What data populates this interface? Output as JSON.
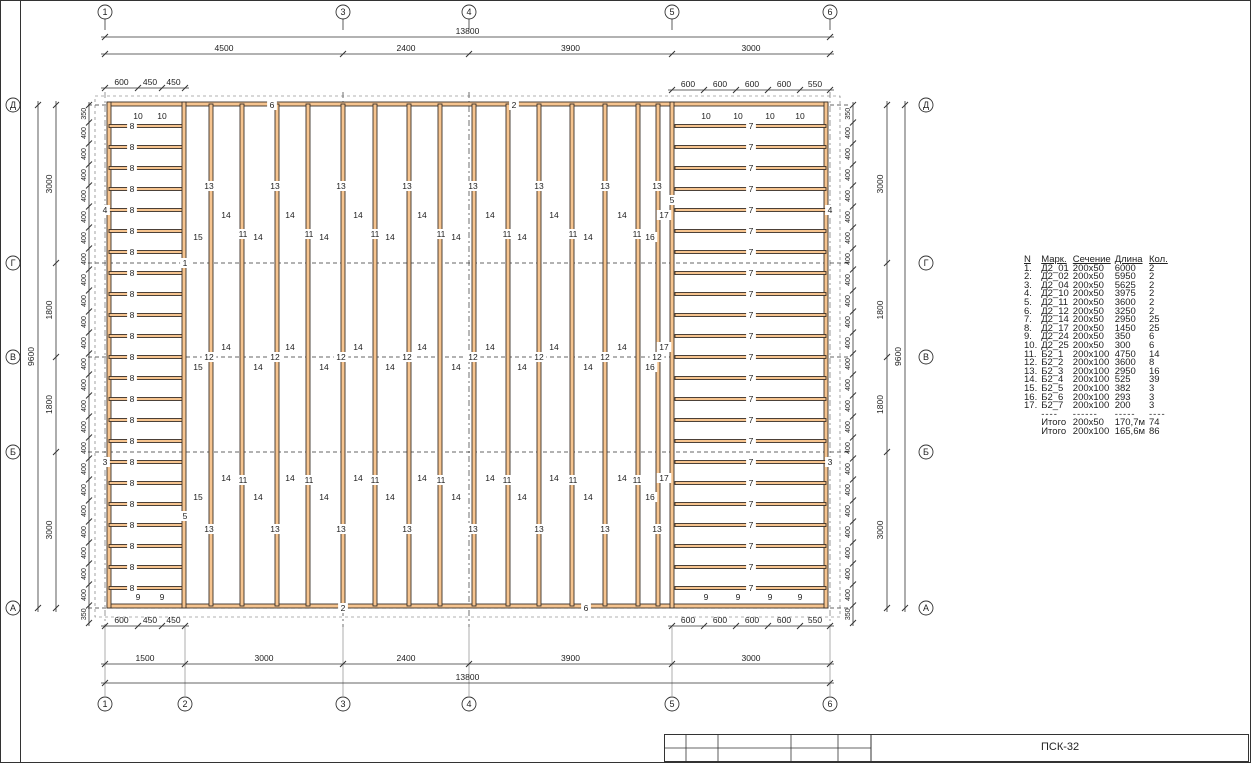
{
  "axes_top": [
    "1",
    "3",
    "4",
    "5",
    "6"
  ],
  "axes_bottom": [
    "1",
    "2",
    "3",
    "4",
    "5",
    "6"
  ],
  "axes_left": [
    "Д",
    "Г",
    "В",
    "Б",
    "А"
  ],
  "axes_right": [
    "Д",
    "Г",
    "В",
    "Б",
    "А"
  ],
  "dims_top": {
    "total": "13800",
    "spans": [
      "4500",
      "2400",
      "3900",
      "3000"
    ],
    "left_detail": [
      "600",
      "450",
      "450"
    ],
    "right_detail": [
      "600",
      "600",
      "600",
      "600",
      "550"
    ]
  },
  "dims_bottom": {
    "total": "13800",
    "spans": [
      "1500",
      "3000",
      "2400",
      "3900",
      "3000"
    ],
    "left_detail": [
      "600",
      "450",
      "450"
    ],
    "right_detail": [
      "600",
      "600",
      "600",
      "600",
      "550"
    ]
  },
  "dims_left": {
    "total": "9600",
    "spans": [
      "3000",
      "1800",
      "1800",
      "3000"
    ]
  },
  "dims_right": {
    "total": "9600",
    "spans": [
      "3000",
      "1800",
      "1800",
      "3000"
    ]
  },
  "side_spacing": [
    "350",
    "400",
    "400",
    "400",
    "400",
    "400",
    "400",
    "400",
    "400",
    "400",
    "400",
    "400",
    "400",
    "400",
    "400",
    "400",
    "400",
    "400",
    "400",
    "400",
    "400",
    "400",
    "400",
    "400",
    "350"
  ],
  "marks": {
    "top_left": [
      "10",
      "10"
    ],
    "top_right": [
      "10",
      "10",
      "10",
      "10"
    ],
    "bottom_left": [
      "9",
      "9"
    ],
    "bottom_right": [
      "9",
      "9",
      "9",
      "9"
    ],
    "joist_left": "8",
    "joist_right": "7",
    "beam_long": "13",
    "beam_mid": "12",
    "beam_short": "11",
    "block": "14",
    "block_left": "15",
    "block_right": "16",
    "block_right2": "17",
    "rim_top_a": "6",
    "rim_top_b": "2",
    "rim_bottom_a": "2",
    "rim_bottom_b": "6",
    "rim_left_a": "4",
    "rim_left_b": "1",
    "rim_left_c": "3",
    "rim_left_d": "5",
    "rim_right_a": "4",
    "rim_right_b": "5",
    "rim_right_c": "3"
  },
  "spec": {
    "headers": [
      "N",
      "Марк.",
      "Сечение",
      "Длина",
      "Кол."
    ],
    "rows": [
      [
        "1.",
        "Д2_01",
        "200x50",
        "6000",
        "2"
      ],
      [
        "2.",
        "Д2_02",
        "200x50",
        "5950",
        "2"
      ],
      [
        "3.",
        "Д2_04",
        "200x50",
        "5625",
        "2"
      ],
      [
        "4.",
        "Д2_10",
        "200x50",
        "3975",
        "2"
      ],
      [
        "5.",
        "Д2_11",
        "200x50",
        "3600",
        "2"
      ],
      [
        "6.",
        "Д2_12",
        "200x50",
        "3250",
        "2"
      ],
      [
        "7.",
        "Д2_14",
        "200x50",
        "2950",
        "25"
      ],
      [
        "8.",
        "Д2_17",
        "200x50",
        "1450",
        "25"
      ],
      [
        "9.",
        "Д2_24",
        "200x50",
        "350",
        "6"
      ],
      [
        "10.",
        "Д2_25",
        "200x50",
        "300",
        "6"
      ],
      [
        "11.",
        "Б2_1",
        "200x100",
        "4750",
        "14"
      ],
      [
        "12.",
        "Б2_2",
        "200x100",
        "3600",
        "8"
      ],
      [
        "13.",
        "Б2_3",
        "200x100",
        "2950",
        "16"
      ],
      [
        "14.",
        "Б2_4",
        "200x100",
        "525",
        "39"
      ],
      [
        "15.",
        "Б2_5",
        "200x100",
        "382",
        "3"
      ],
      [
        "16.",
        "Б2_6",
        "200x100",
        "293",
        "3"
      ],
      [
        "17.",
        "Б2_7",
        "200x100",
        "200",
        "3"
      ]
    ],
    "separator": [
      "",
      "----",
      "------",
      "-----",
      "----"
    ],
    "totals": [
      [
        "",
        "Итого",
        "200x50",
        "170,7м",
        "74"
      ],
      [
        "",
        "Итого",
        "200x100",
        "165,6м",
        "86"
      ]
    ]
  },
  "stamp": {
    "code": "ПСК-32"
  },
  "colors": {
    "wood": "#f6c48f",
    "wood_edge": "#3a3028",
    "line": "#333333"
  }
}
